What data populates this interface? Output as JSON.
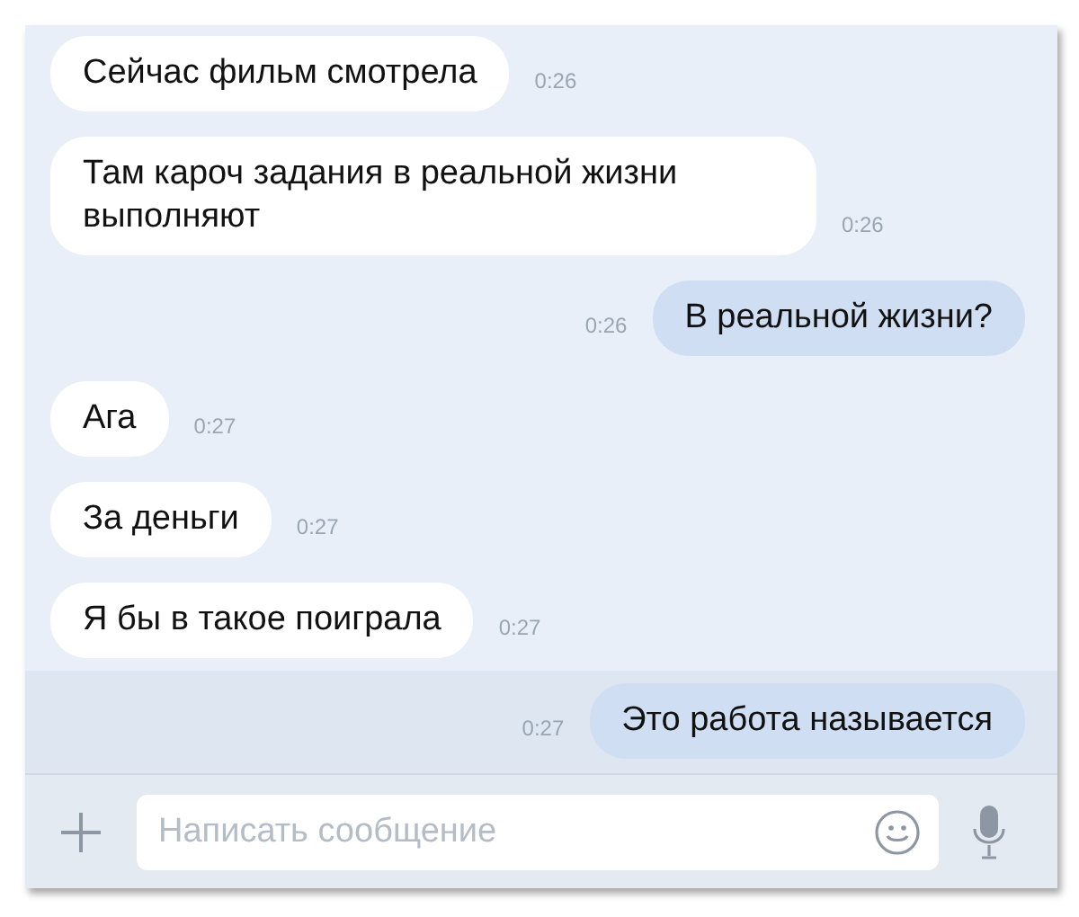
{
  "messages": [
    {
      "kind": "incoming",
      "text": "Сейчас фильм смотрела",
      "time": "0:26",
      "unread": false
    },
    {
      "kind": "incoming",
      "text": "Там кароч задания в реальной жизни выполняют",
      "time": "0:26",
      "unread": false
    },
    {
      "kind": "outgoing",
      "text": "В реальной жизни?",
      "time": "0:26",
      "unread": false
    },
    {
      "kind": "incoming",
      "text": "Ага",
      "time": "0:27",
      "unread": false
    },
    {
      "kind": "incoming",
      "text": "За деньги",
      "time": "0:27",
      "unread": false
    },
    {
      "kind": "incoming",
      "text": "Я бы в такое поиграла",
      "time": "0:27",
      "unread": false
    },
    {
      "kind": "outgoing",
      "text": "Это работа называется",
      "time": "0:27",
      "unread": true
    }
  ],
  "composer": {
    "placeholder": "Написать сообщение"
  }
}
